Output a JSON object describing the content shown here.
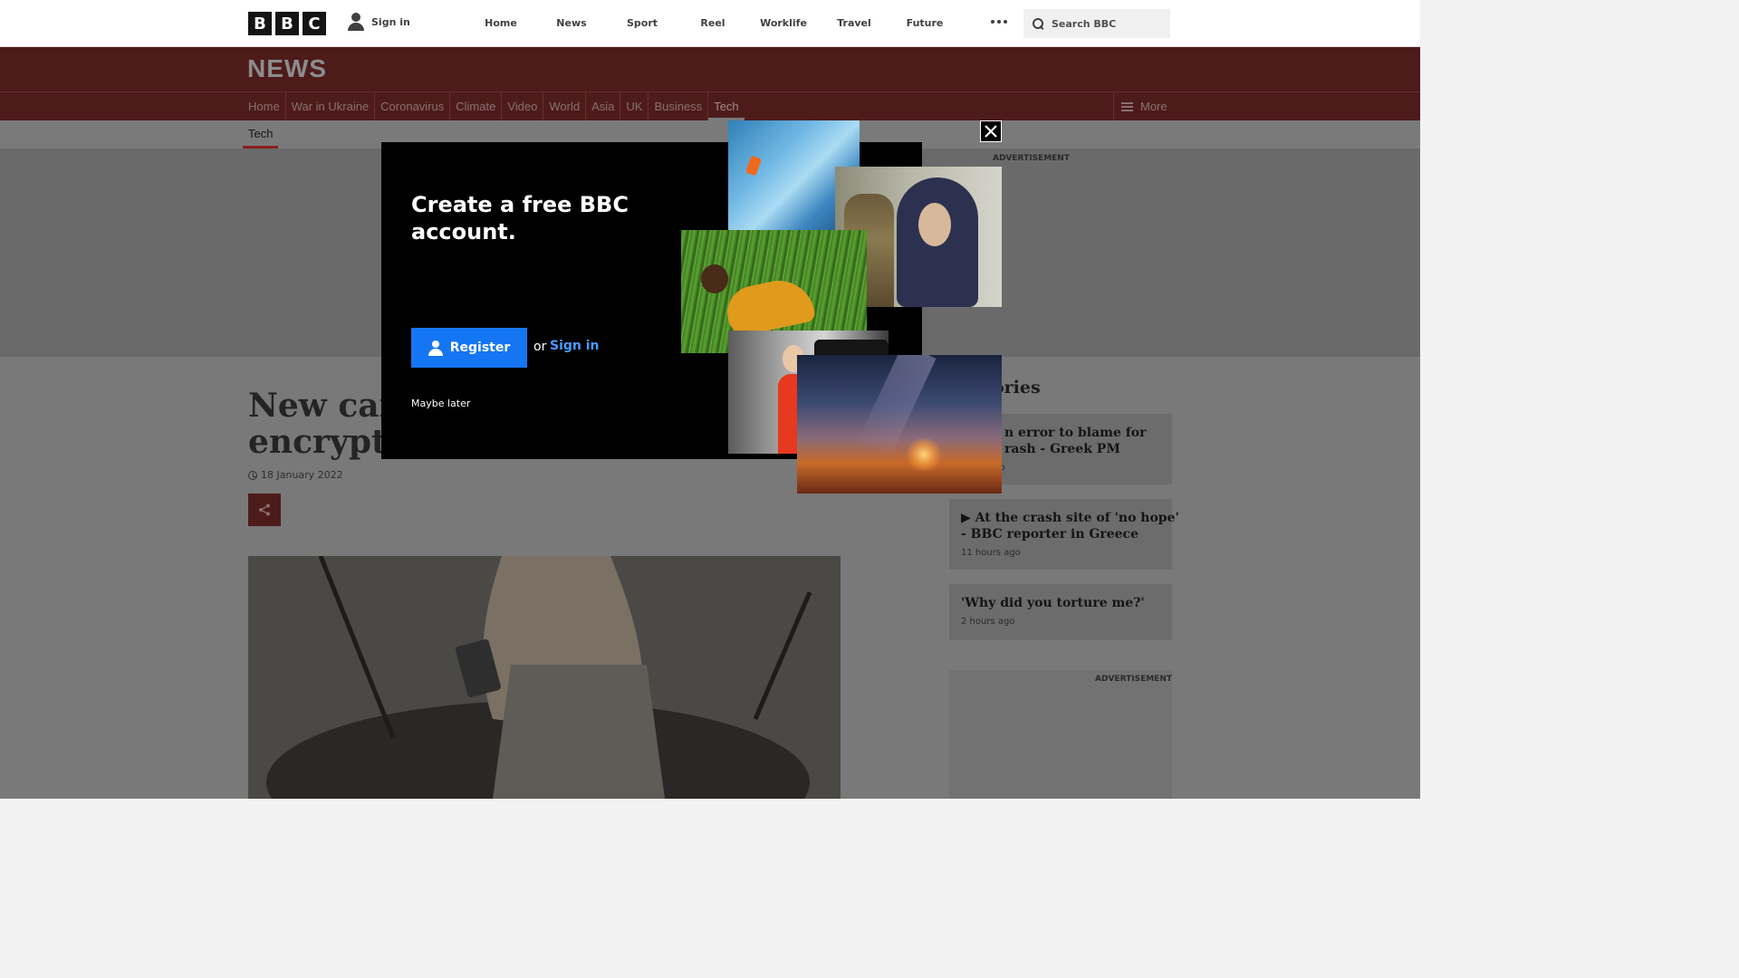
{
  "global_nav": {
    "logo_letters": [
      "B",
      "B",
      "C"
    ],
    "signin_label": "Sign in",
    "links": [
      "Home",
      "News",
      "Sport",
      "Reel",
      "Worklife",
      "Travel",
      "Future"
    ],
    "search_placeholder": "Search BBC"
  },
  "news_masthead": {
    "title": "NEWS",
    "nav_items": [
      "Home",
      "War in Ukraine",
      "Coronavirus",
      "Climate",
      "Video",
      "World",
      "Asia",
      "UK",
      "Business",
      "Tech"
    ],
    "active_item": "Tech",
    "more_label": "More",
    "sub_tab": "Tech"
  },
  "article": {
    "headline": "New cam\nencrypte",
    "date": "18 January 2022"
  },
  "ads": {
    "label": "ADVERTISEMENT"
  },
  "top_stories": {
    "title": "ories",
    "items": [
      {
        "headline": "n error to blame for\nrash - Greek PM",
        "time": "go"
      },
      {
        "headline": "At the crash site of 'no hope'\n- BBC reporter in Greece",
        "time": "11 hours ago",
        "video": true
      },
      {
        "headline": "'Why did you torture me?'",
        "time": "2 hours ago"
      }
    ]
  },
  "modal": {
    "title": "Create a free BBC account.",
    "register_label": "Register",
    "or_text": "or",
    "signin_label": "Sign in",
    "maybe_later_label": "Maybe later"
  },
  "colors": {
    "news_red": "#bb1919",
    "register_blue": "#1476f2",
    "signin_link_blue": "#4a9bff"
  }
}
